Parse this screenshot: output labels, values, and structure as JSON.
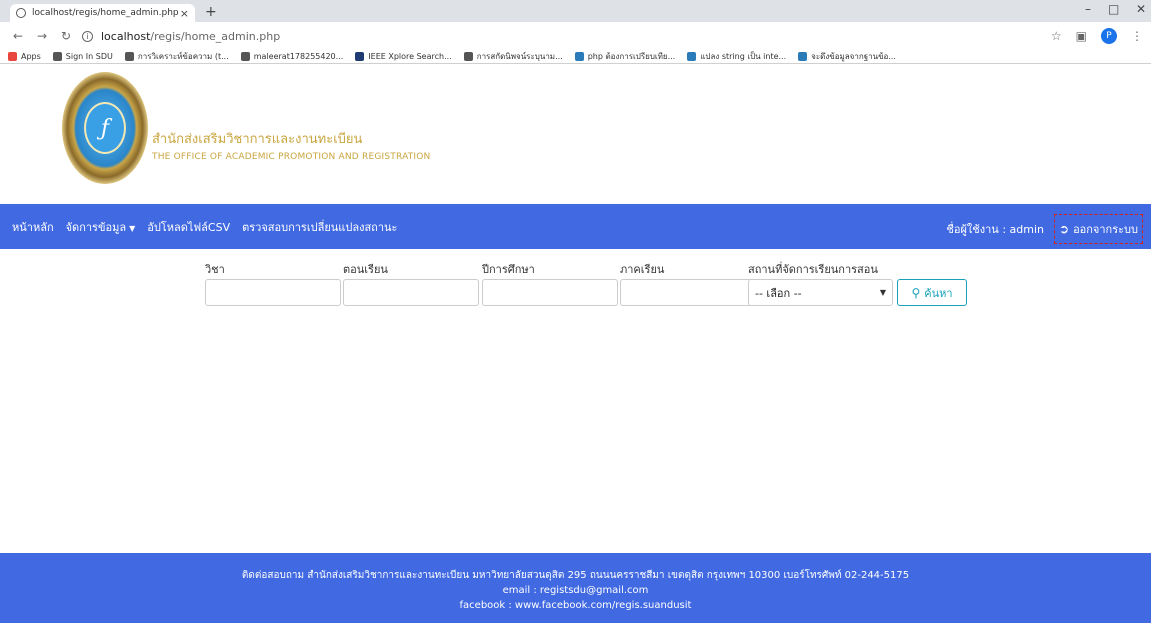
{
  "browser": {
    "tab_title": "localhost/regis/home_admin.php",
    "tab_close": "×",
    "new_tab": "+",
    "url_host": "localhost",
    "url_path": "/regis/home_admin.php",
    "avatar_letter": "P",
    "bookmarks": [
      {
        "label": "Apps",
        "color": "#e8453c"
      },
      {
        "label": "Sign In SDU",
        "color": "#555555"
      },
      {
        "label": "การวิเคราะห์ข้อความ (t...",
        "color": "#555555"
      },
      {
        "label": "maleerat178255420...",
        "color": "#555555"
      },
      {
        "label": "IEEE Xplore Search...",
        "color": "#1f3b73"
      },
      {
        "label": "การสกัดนิพจน์ระบุนาม...",
        "color": "#555555"
      },
      {
        "label": "php ต้องการเปรียบเทีย...",
        "color": "#2b7bb9"
      },
      {
        "label": "แปลง string เป็น inte...",
        "color": "#2b7bb9"
      },
      {
        "label": "จะดึงข้อมูลจากฐานข้อ...",
        "color": "#2b7bb9"
      }
    ]
  },
  "header": {
    "org_name_th": "สำนักส่งเสริมวิชาการและงานทะเบียน",
    "org_name_en": "THE OFFICE OF ACADEMIC PROMOTION AND REGISTRATION"
  },
  "nav": {
    "home": "หน้าหลัก",
    "manage_data": "จัดการข้อมูล",
    "upload_csv": "อัปโหลดไฟล์CSV",
    "check_status": "ตรวจสอบการเปลี่ยนแปลงสถานะ",
    "user_label": "ชื่อผู้ใช้งาน : admin",
    "logout": "ออกจากระบบ"
  },
  "search": {
    "subject_label": "วิชา",
    "section_label": "ตอนเรียน",
    "year_label": "ปีการศึกษา",
    "semester_label": "ภาคเรียน",
    "location_label": "สถานที่จัดการเรียนการสอน",
    "location_selected": "-- เลือก --",
    "search_button": "ค้นหา"
  },
  "footer": {
    "line1": "ติดต่อสอบถาม สำนักส่งเสริมวิชาการและงานทะเบียน มหาวิทยาลัยสวนดุสิต 295 ถนนนครราชสีมา เขตดุสิต กรุงเทพฯ 10300 เบอร์โทรศัพท์ 02-244-5175",
    "line2": "email : registsdu@gmail.com",
    "line3": "facebook : www.facebook.com/regis.suandusit"
  },
  "colors": {
    "navbar": "#4169e1",
    "org_text": "#c9a640",
    "search_button": "#17a2b8",
    "logout_border": "#cc2222"
  }
}
